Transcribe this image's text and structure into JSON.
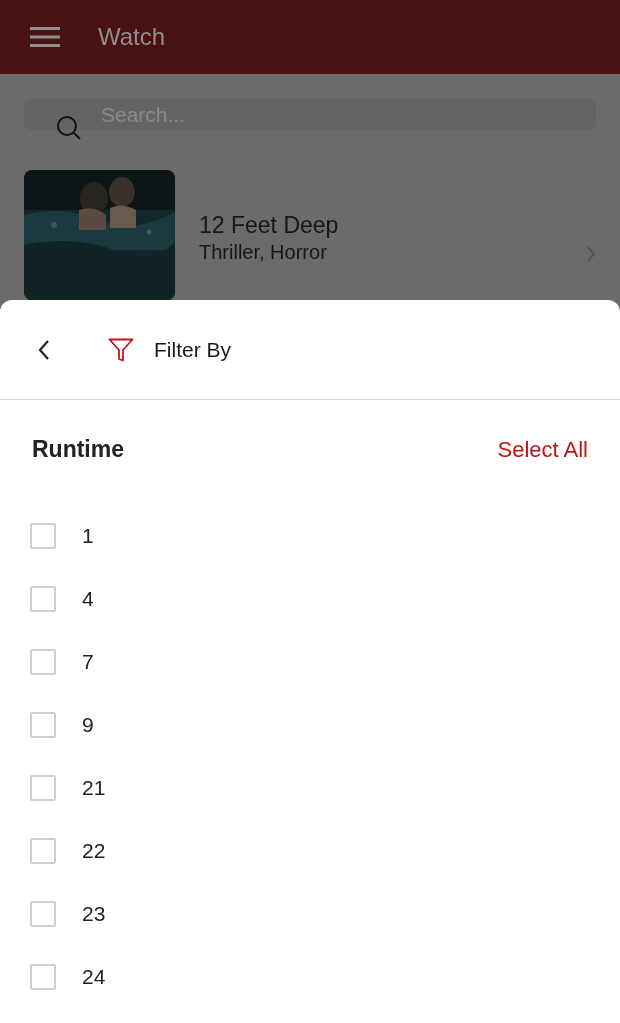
{
  "app_bar": {
    "title": "Watch"
  },
  "search": {
    "placeholder": "Search..."
  },
  "movies": [
    {
      "kind": "picture",
      "title": "12 Feet Deep",
      "genres": "Thriller, Horror"
    }
  ],
  "filter_sheet": {
    "title": "Filter By",
    "section": "Runtime",
    "select_all": "Select All",
    "options": [
      {
        "label": "1",
        "checked": false
      },
      {
        "label": "4",
        "checked": false
      },
      {
        "label": "7",
        "checked": false
      },
      {
        "label": "9",
        "checked": false
      },
      {
        "label": "21",
        "checked": false
      },
      {
        "label": "22",
        "checked": false
      },
      {
        "label": "23",
        "checked": false
      },
      {
        "label": "24",
        "checked": false
      }
    ]
  }
}
